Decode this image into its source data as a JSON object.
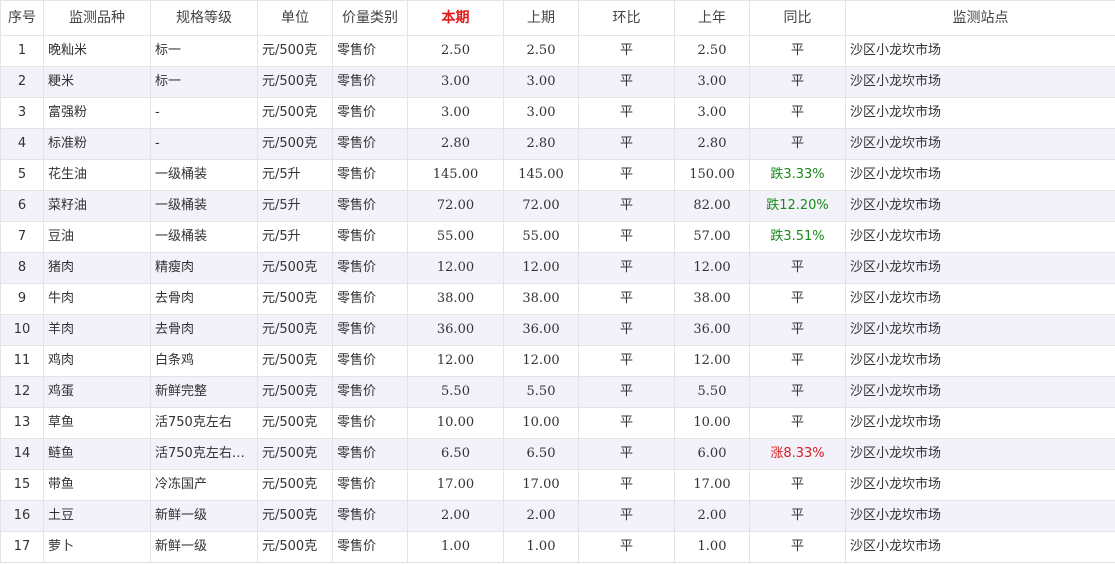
{
  "headers": [
    "序号",
    "监测品种",
    "规格等级",
    "单位",
    "价量类别",
    "本期",
    "上期",
    "环比",
    "上年",
    "同比",
    "监测站点"
  ],
  "colors": {
    "current_header": "#e01b1b",
    "yoy_down": "#1a8a1a",
    "yoy_up": "#d81e1e",
    "stripe": "#f3f2fb"
  },
  "rows": [
    {
      "no": "1",
      "item": "晚籼米",
      "grade": "标一",
      "unit": "元/500克",
      "type": "零售价",
      "current": "2.50",
      "previous": "2.50",
      "mom": "平",
      "last_year": "2.50",
      "yoy": "平",
      "yoy_trend": "flat",
      "station": "沙区小龙坎市场"
    },
    {
      "no": "2",
      "item": "粳米",
      "grade": "标一",
      "unit": "元/500克",
      "type": "零售价",
      "current": "3.00",
      "previous": "3.00",
      "mom": "平",
      "last_year": "3.00",
      "yoy": "平",
      "yoy_trend": "flat",
      "station": "沙区小龙坎市场"
    },
    {
      "no": "3",
      "item": "富强粉",
      "grade": "-",
      "unit": "元/500克",
      "type": "零售价",
      "current": "3.00",
      "previous": "3.00",
      "mom": "平",
      "last_year": "3.00",
      "yoy": "平",
      "yoy_trend": "flat",
      "station": "沙区小龙坎市场"
    },
    {
      "no": "4",
      "item": "标准粉",
      "grade": "-",
      "unit": "元/500克",
      "type": "零售价",
      "current": "2.80",
      "previous": "2.80",
      "mom": "平",
      "last_year": "2.80",
      "yoy": "平",
      "yoy_trend": "flat",
      "station": "沙区小龙坎市场"
    },
    {
      "no": "5",
      "item": "花生油",
      "grade": "一级桶装",
      "unit": "元/5升",
      "type": "零售价",
      "current": "145.00",
      "previous": "145.00",
      "mom": "平",
      "last_year": "150.00",
      "yoy": "跌3.33%",
      "yoy_trend": "down",
      "station": "沙区小龙坎市场"
    },
    {
      "no": "6",
      "item": "菜籽油",
      "grade": "一级桶装",
      "unit": "元/5升",
      "type": "零售价",
      "current": "72.00",
      "previous": "72.00",
      "mom": "平",
      "last_year": "82.00",
      "yoy": "跌12.20%",
      "yoy_trend": "down",
      "station": "沙区小龙坎市场"
    },
    {
      "no": "7",
      "item": "豆油",
      "grade": "一级桶装",
      "unit": "元/5升",
      "type": "零售价",
      "current": "55.00",
      "previous": "55.00",
      "mom": "平",
      "last_year": "57.00",
      "yoy": "跌3.51%",
      "yoy_trend": "down",
      "station": "沙区小龙坎市场"
    },
    {
      "no": "8",
      "item": "猪肉",
      "grade": "精瘦肉",
      "unit": "元/500克",
      "type": "零售价",
      "current": "12.00",
      "previous": "12.00",
      "mom": "平",
      "last_year": "12.00",
      "yoy": "平",
      "yoy_trend": "flat",
      "station": "沙区小龙坎市场"
    },
    {
      "no": "9",
      "item": "牛肉",
      "grade": "去骨肉",
      "unit": "元/500克",
      "type": "零售价",
      "current": "38.00",
      "previous": "38.00",
      "mom": "平",
      "last_year": "38.00",
      "yoy": "平",
      "yoy_trend": "flat",
      "station": "沙区小龙坎市场"
    },
    {
      "no": "10",
      "item": "羊肉",
      "grade": "去骨肉",
      "unit": "元/500克",
      "type": "零售价",
      "current": "36.00",
      "previous": "36.00",
      "mom": "平",
      "last_year": "36.00",
      "yoy": "平",
      "yoy_trend": "flat",
      "station": "沙区小龙坎市场"
    },
    {
      "no": "11",
      "item": "鸡肉",
      "grade": "白条鸡",
      "unit": "元/500克",
      "type": "零售价",
      "current": "12.00",
      "previous": "12.00",
      "mom": "平",
      "last_year": "12.00",
      "yoy": "平",
      "yoy_trend": "flat",
      "station": "沙区小龙坎市场"
    },
    {
      "no": "12",
      "item": "鸡蛋",
      "grade": "新鲜完整",
      "unit": "元/500克",
      "type": "零售价",
      "current": "5.50",
      "previous": "5.50",
      "mom": "平",
      "last_year": "5.50",
      "yoy": "平",
      "yoy_trend": "flat",
      "station": "沙区小龙坎市场"
    },
    {
      "no": "13",
      "item": "草鱼",
      "grade": "活750克左右",
      "unit": "元/500克",
      "type": "零售价",
      "current": "10.00",
      "previous": "10.00",
      "mom": "平",
      "last_year": "10.00",
      "yoy": "平",
      "yoy_trend": "flat",
      "station": "沙区小龙坎市场"
    },
    {
      "no": "14",
      "item": "鲢鱼",
      "grade": "活750克左右…",
      "unit": "元/500克",
      "type": "零售价",
      "current": "6.50",
      "previous": "6.50",
      "mom": "平",
      "last_year": "6.00",
      "yoy": "涨8.33%",
      "yoy_trend": "up",
      "station": "沙区小龙坎市场"
    },
    {
      "no": "15",
      "item": "带鱼",
      "grade": "冷冻国产",
      "unit": "元/500克",
      "type": "零售价",
      "current": "17.00",
      "previous": "17.00",
      "mom": "平",
      "last_year": "17.00",
      "yoy": "平",
      "yoy_trend": "flat",
      "station": "沙区小龙坎市场"
    },
    {
      "no": "16",
      "item": "土豆",
      "grade": "新鲜一级",
      "unit": "元/500克",
      "type": "零售价",
      "current": "2.00",
      "previous": "2.00",
      "mom": "平",
      "last_year": "2.00",
      "yoy": "平",
      "yoy_trend": "flat",
      "station": "沙区小龙坎市场"
    },
    {
      "no": "17",
      "item": "萝卜",
      "grade": "新鲜一级",
      "unit": "元/500克",
      "type": "零售价",
      "current": "1.00",
      "previous": "1.00",
      "mom": "平",
      "last_year": "1.00",
      "yoy": "平",
      "yoy_trend": "flat",
      "station": "沙区小龙坎市场"
    }
  ]
}
